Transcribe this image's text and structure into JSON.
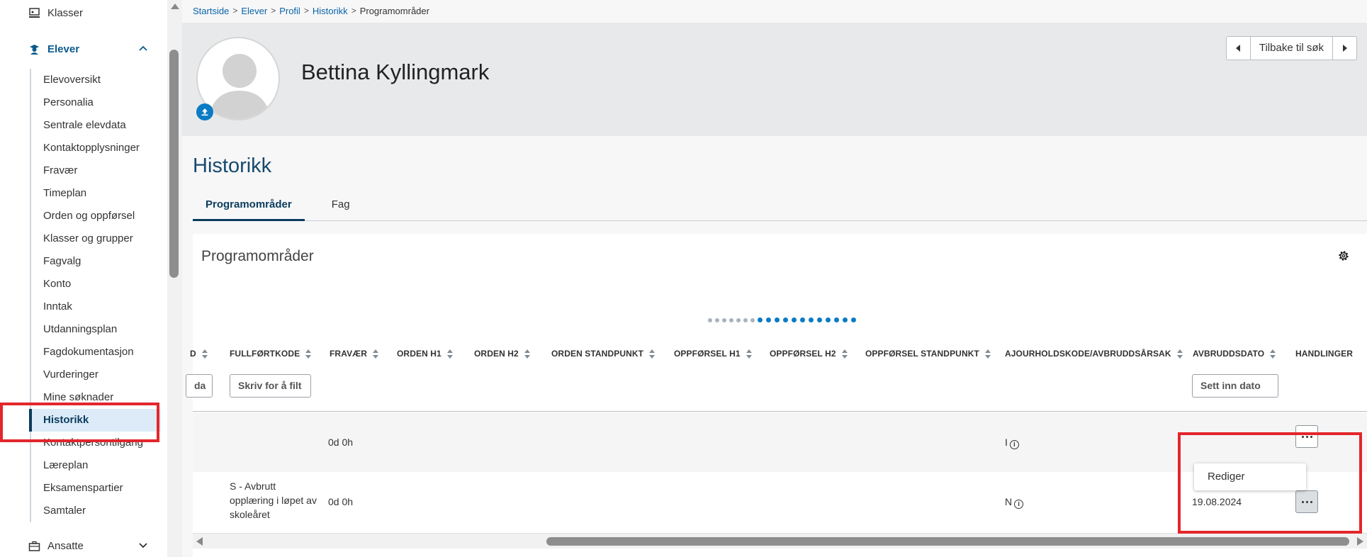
{
  "sidebar": {
    "top_item": {
      "label": "Klasser",
      "icon": "classes-icon"
    },
    "group": {
      "label": "Elever",
      "icon": "student-icon",
      "expanded": true
    },
    "items": [
      {
        "label": "Elevoversikt"
      },
      {
        "label": "Personalia"
      },
      {
        "label": "Sentrale elevdata"
      },
      {
        "label": "Kontaktopplysninger"
      },
      {
        "label": "Fravær"
      },
      {
        "label": "Timeplan"
      },
      {
        "label": "Orden og oppførsel"
      },
      {
        "label": "Klasser og grupper"
      },
      {
        "label": "Fagvalg"
      },
      {
        "label": "Konto"
      },
      {
        "label": "Inntak"
      },
      {
        "label": "Utdanningsplan"
      },
      {
        "label": "Fagdokumentasjon"
      },
      {
        "label": "Vurderinger"
      },
      {
        "label": "Mine søknader"
      },
      {
        "label": "Historikk",
        "active": true
      },
      {
        "label": "Kontaktpersontilgang"
      },
      {
        "label": "Læreplan"
      },
      {
        "label": "Eksamenspartier"
      },
      {
        "label": "Samtaler"
      }
    ],
    "bottom_group": {
      "label": "Ansatte",
      "icon": "briefcase-icon"
    }
  },
  "breadcrumb": [
    "Startside",
    "Elever",
    "Profil",
    "Historikk",
    "Programområder"
  ],
  "profile": {
    "name": "Bettina Kyllingmark",
    "back_label": "Tilbake til søk"
  },
  "page": {
    "title": "Historikk",
    "tabs": [
      "Programområder",
      "Fag"
    ],
    "active_tab": "Programområder"
  },
  "table": {
    "title": "Programområder",
    "page_dots": {
      "total": 19,
      "active_from": 7
    },
    "columns": [
      "D",
      "FULLFØRTKODE",
      "FRAVÆR",
      "ORDEN H1",
      "ORDEN H2",
      "ORDEN STANDPUNKT",
      "OPPFØRSEL H1",
      "OPPFØRSEL H2",
      "OPPFØRSEL STANDPUNKT",
      "AJOURHOLDSKODE/AVBRUDDSÅRSAK",
      "AVBRUDDSDATO",
      "HANDLINGER"
    ],
    "filters": {
      "col_d": "da",
      "fullfortkode": "Skriv for å filt",
      "avbruddsdato": "Sett inn dato"
    },
    "rows": [
      {
        "fullfortkode": "",
        "fravaer": "0d 0h",
        "ajourhold": "I",
        "avbruddsdato": ""
      },
      {
        "fullfortkode": "S - Avbrutt opplæring i løpet av skoleåret",
        "fravaer": "0d 0h",
        "ajourhold": "N",
        "avbruddsdato": "19.08.2024"
      }
    ],
    "row_menu": {
      "items": [
        "Rediger"
      ]
    }
  },
  "colors": {
    "accent": "#0a7bc4",
    "nav_active_bg": "#dcebf7",
    "heading": "#174a6e",
    "annotation": "#e3262b"
  }
}
